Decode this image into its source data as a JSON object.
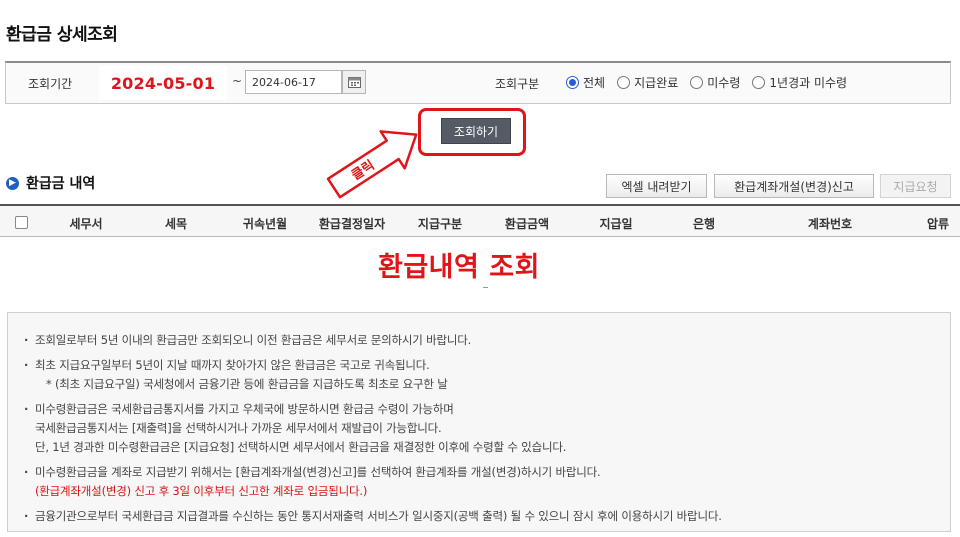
{
  "page_title": "환급금 상세조회",
  "search": {
    "period_label": "조회기간",
    "start_date": "2024-05-01",
    "tilde": "~",
    "end_date": "2024-06-17",
    "type_label": "조회구분",
    "options": [
      "전체",
      "지급완료",
      "미수령",
      "1년경과 미수령"
    ],
    "selected_option": "전체",
    "search_button": "조회하기"
  },
  "annotation": {
    "arrow_label": "클릭",
    "overlay": "환급내역 조회",
    "highlight_color": "#e0151a"
  },
  "section": {
    "title": "환급금 내역",
    "excel_button": "엑셀 내려받기",
    "account_button": "환급계좌개설(변경)신고",
    "request_button": "지급요청"
  },
  "table": {
    "columns": [
      "세무서",
      "세목",
      "귀속년월",
      "환급결정일자",
      "지급구분",
      "환급금액",
      "지급일",
      "은행",
      "계좌번호",
      "압류"
    ]
  },
  "notes": [
    {
      "text": "조회일로부터 5년 이내의 환급금만 조회되오니 이전 환급금은 세무서로 문의하시기 바랍니다.",
      "sub": false
    },
    {
      "text": "최초 지급요구일부터 5년이 지날 때까지 찾아가지 않은 환급금은 국고로 귀속됩니다.",
      "sub": false
    },
    {
      "text": "* (최초 지급요구일) 국세청에서 금융기관 등에 환급금을 지급하도록 최초로 요구한 날",
      "sub": true
    },
    {
      "text": "미수령환급금은 국세환급금통지서를 가지고 우체국에 방문하시면 환급금 수령이 가능하며",
      "sub": false
    },
    {
      "text": "국세환급금통지서는 [재출력]을 선택하시거나 가까운 세무서에서 재발급이 가능합니다.",
      "sub": true
    },
    {
      "text": "단, 1년 경과한 미수령환급금은 [지급요청] 선택하시면 세무서에서 환급금을 재결정한 이후에 수령할 수 있습니다.",
      "sub": true
    },
    {
      "text": "미수령환급금을 계좌로 지급받기 위해서는 [환급계좌개설(변경)신고]를 선택하여 환급계좌를 개설(변경)하시기 바랍니다.",
      "sub": false
    },
    {
      "text": "(환급계좌개설(변경) 신고 후 3일 이후부터 신고한 계좌로 입금됩니다.)",
      "sub": true,
      "red": true
    },
    {
      "text": "금융기관으로부터 국세환급금 지급결과를 수신하는 동안 통지서재출력 서비스가 일시중지(공백 출력) 될 수 있으니 잠시 후에 이용하시기 바랍니다.",
      "sub": false
    }
  ]
}
